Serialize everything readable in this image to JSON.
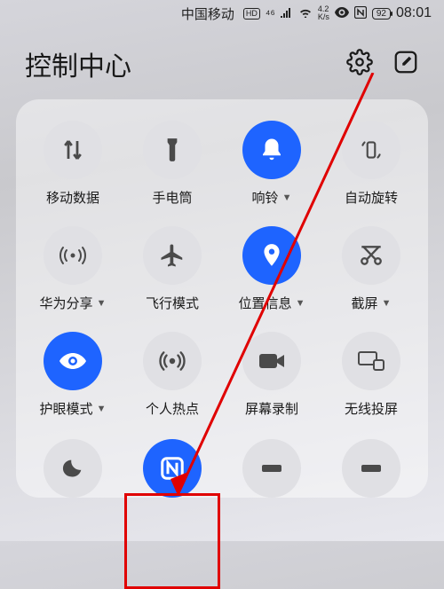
{
  "status": {
    "carrier": "中国移动",
    "hd": "HD",
    "signal_tag": "⁴⁶",
    "net_speed": "4.2",
    "net_unit": "K/s",
    "battery": "92",
    "time": "08:01"
  },
  "header": {
    "title": "控制中心"
  },
  "tiles": [
    {
      "label": "移动数据",
      "on": false,
      "chev": false
    },
    {
      "label": "手电筒",
      "on": false,
      "chev": false
    },
    {
      "label": "响铃",
      "on": true,
      "chev": true
    },
    {
      "label": "自动旋转",
      "on": false,
      "chev": false
    },
    {
      "label": "华为分享",
      "on": false,
      "chev": true
    },
    {
      "label": "飞行模式",
      "on": false,
      "chev": false
    },
    {
      "label": "位置信息",
      "on": true,
      "chev": true
    },
    {
      "label": "截屏",
      "on": false,
      "chev": true
    },
    {
      "label": "护眼模式",
      "on": true,
      "chev": true
    },
    {
      "label": "个人热点",
      "on": false,
      "chev": false
    },
    {
      "label": "屏幕录制",
      "on": false,
      "chev": false
    },
    {
      "label": "无线投屏",
      "on": false,
      "chev": false
    }
  ]
}
